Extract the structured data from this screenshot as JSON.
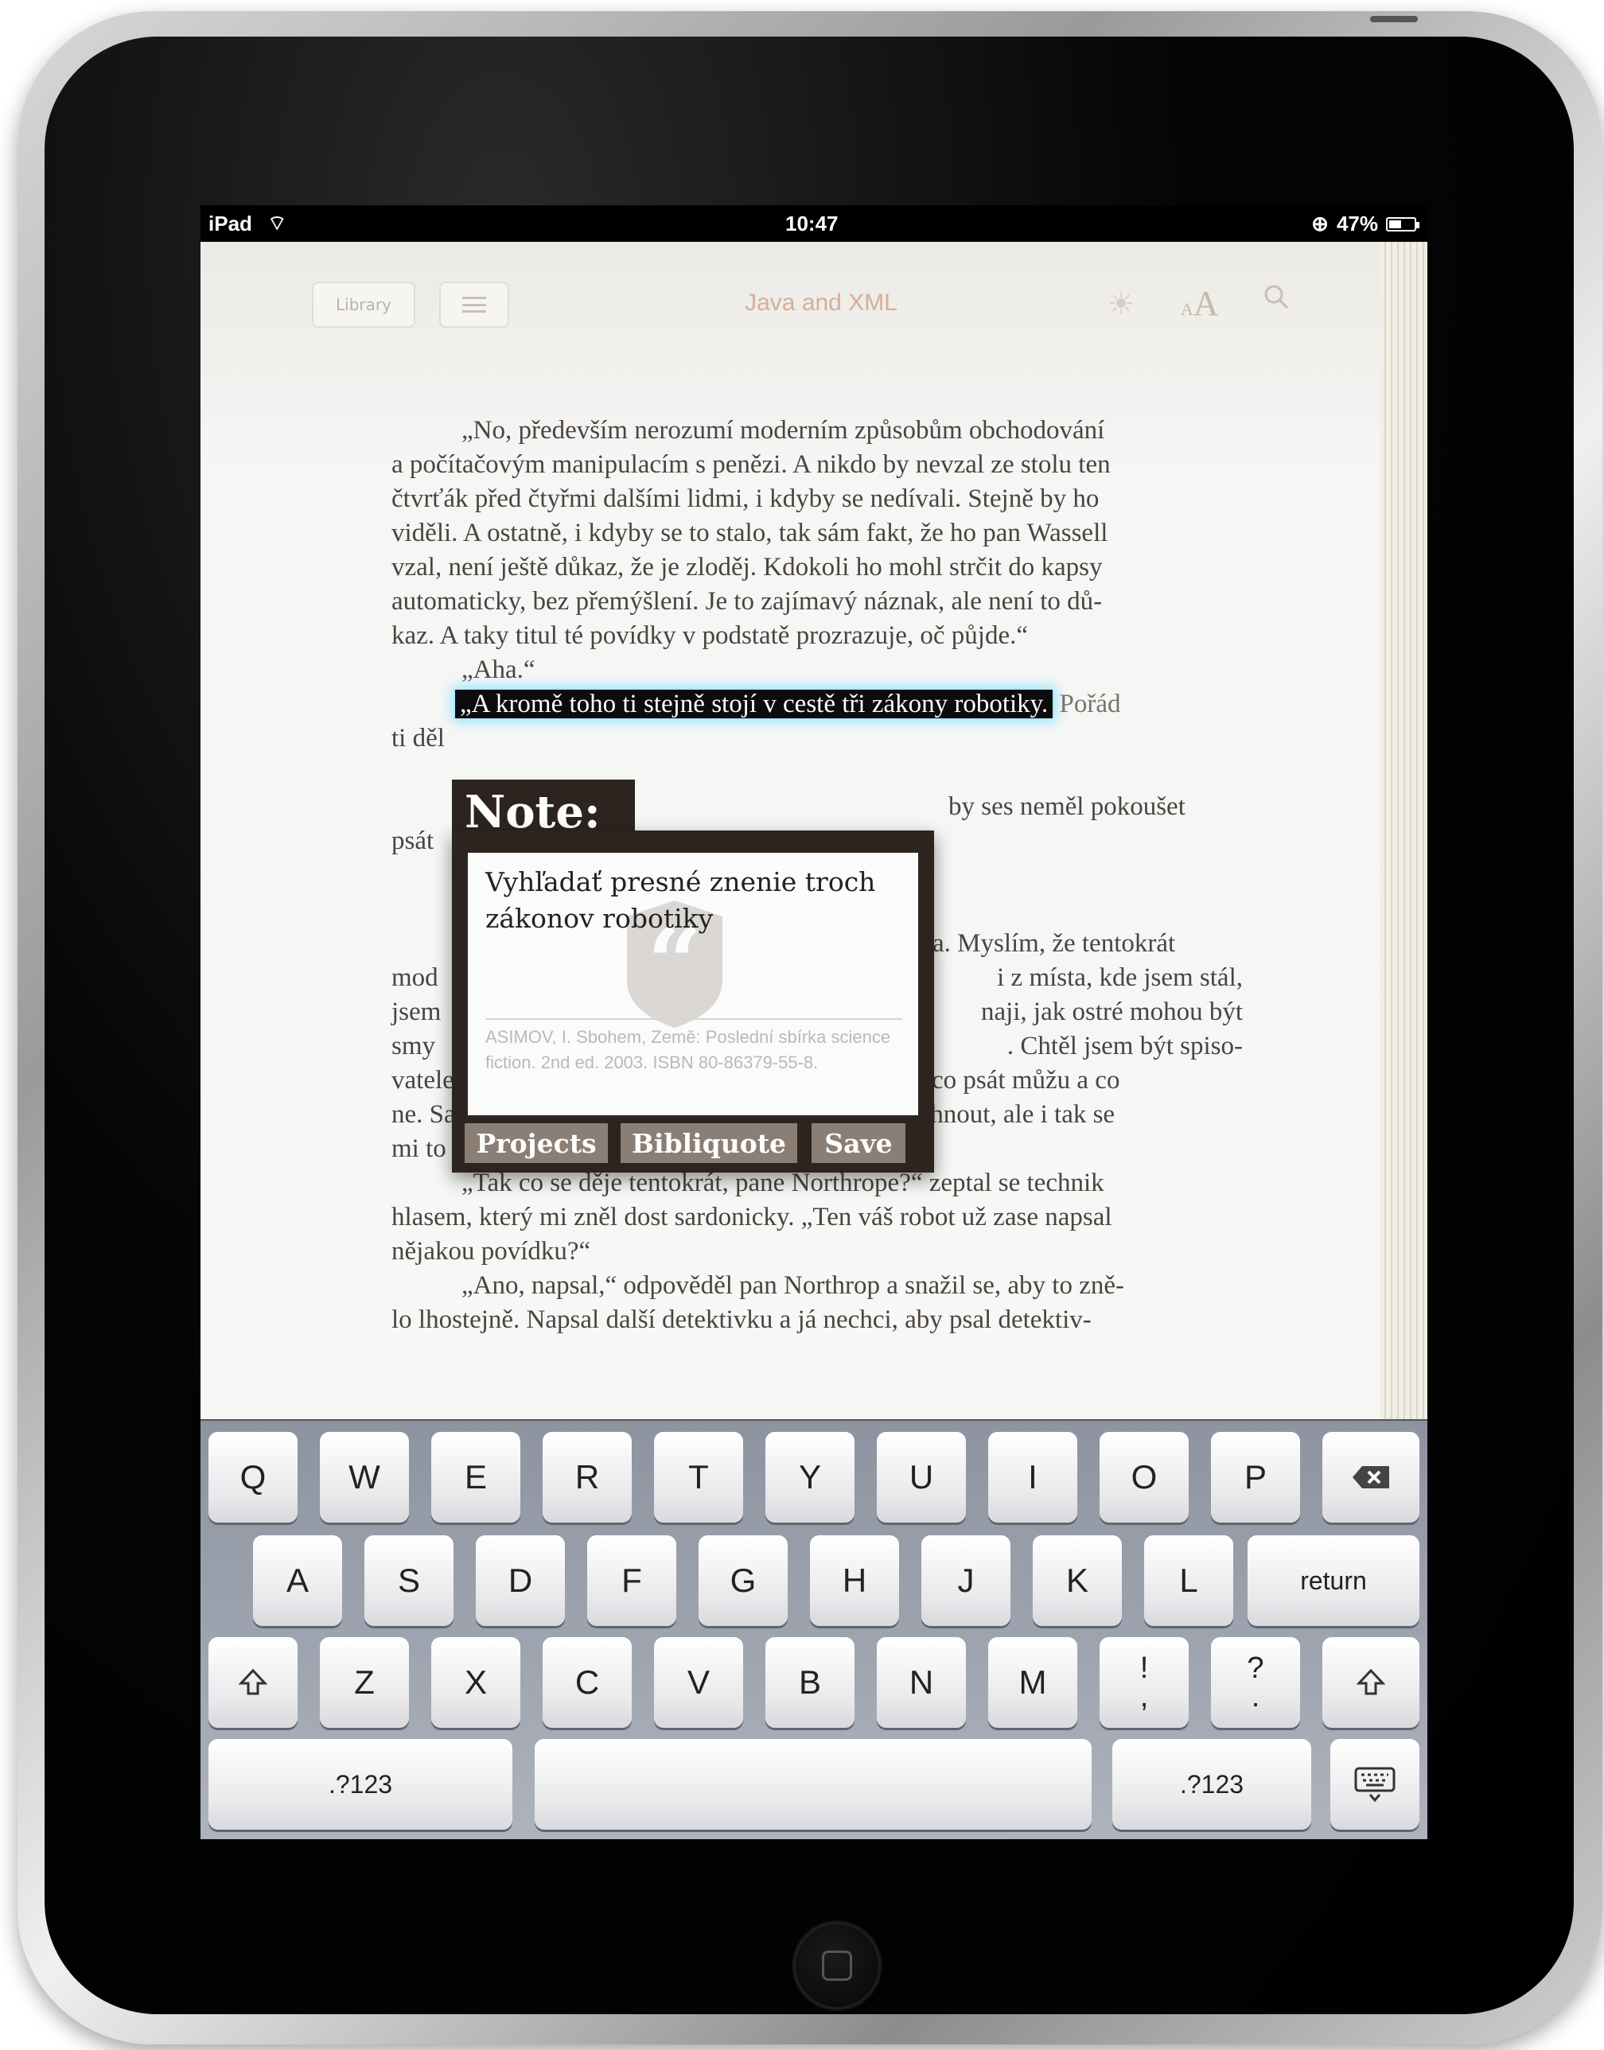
{
  "status_bar": {
    "carrier": "iPad",
    "wifi_icon": "wifi-icon",
    "time": "10:47",
    "battery": "47%"
  },
  "reader": {
    "library_label": "Library",
    "book_title": "Java and XML",
    "lines": [
      "„No, především nerozumí moderním způsobům obchodování",
      "a počítačovým manipulacím s penězi. A nikdo by nevzal ze stolu ten",
      "čtvrťák před čtyřmi dalšími lidmi, i kdyby se nedívali. Stejně by ho",
      "viděli. A ostatně, i kdyby se to stalo, tak sám fakt, že ho pan Wassell",
      "vzal, není ještě důkaz, že je zloděj. Kdokoli ho mohl strčit do kapsy",
      "automaticky, bez přemýšlení. Je to zajímavý náznak, ale není to dů-",
      "kaz. A taky titul té povídky v podstatě prozrazuje, oč půjde.“",
      "„Aha.“",
      "„A kromě toho ti stejně stojí v cestě tři zákony robotiky.",
      "Pořád",
      "ti děl",
      "by ses neměl pokoušet",
      "psát",
      "a. Myslím, že tentokrát",
      "mod",
      "i z místa, kde jsem stál,",
      "jsem",
      "naji, jak ostré mohou být",
      "smy",
      ". Chtěl jsem být spiso-",
      "vatelem a nechtěl jsem, aby mi pan Northrop říkal, co psát můžu a co",
      "ne. Samozřejmě, on je člověk a já ho musím poslechnout, ale i tak se",
      "mi to nelíbilo.",
      "„Tak co se děje tentokrát, pane Northrope?“ zeptal se technik",
      "hlasem, který mi zněl dost sardonicky. „Ten váš robot už zase napsal",
      "nějakou povídku?“",
      "„Ano, napsal,“ odpověděl pan Northrop a snažil se, aby to zně-",
      "lo lhostejně. Napsal další detektivku a já nechci, aby psal detektiv-"
    ]
  },
  "note_popup": {
    "title": "Note:",
    "text": "Vyhľadať presné znenie troch zákonov robotiky",
    "citation": "ASIMOV, I. Sbohem, Země: Poslední sbírka science fiction. 2nd ed. 2003. ISBN 80-86379-55-8.",
    "buttons": {
      "projects": "Projects",
      "bibliquote": "Bibliquote",
      "save": "Save"
    }
  },
  "keyboard": {
    "row1": [
      "Q",
      "W",
      "E",
      "R",
      "T",
      "Y",
      "U",
      "I",
      "O",
      "P"
    ],
    "row2": [
      "A",
      "S",
      "D",
      "F",
      "G",
      "H",
      "J",
      "K",
      "L"
    ],
    "row3": [
      "Z",
      "X",
      "C",
      "V",
      "B",
      "N",
      "M"
    ],
    "return_label": "return",
    "numbers_label": ".?123",
    "punct1_top": "!",
    "punct1_bottom": ",",
    "punct2_top": "?",
    "punct2_bottom": "."
  }
}
